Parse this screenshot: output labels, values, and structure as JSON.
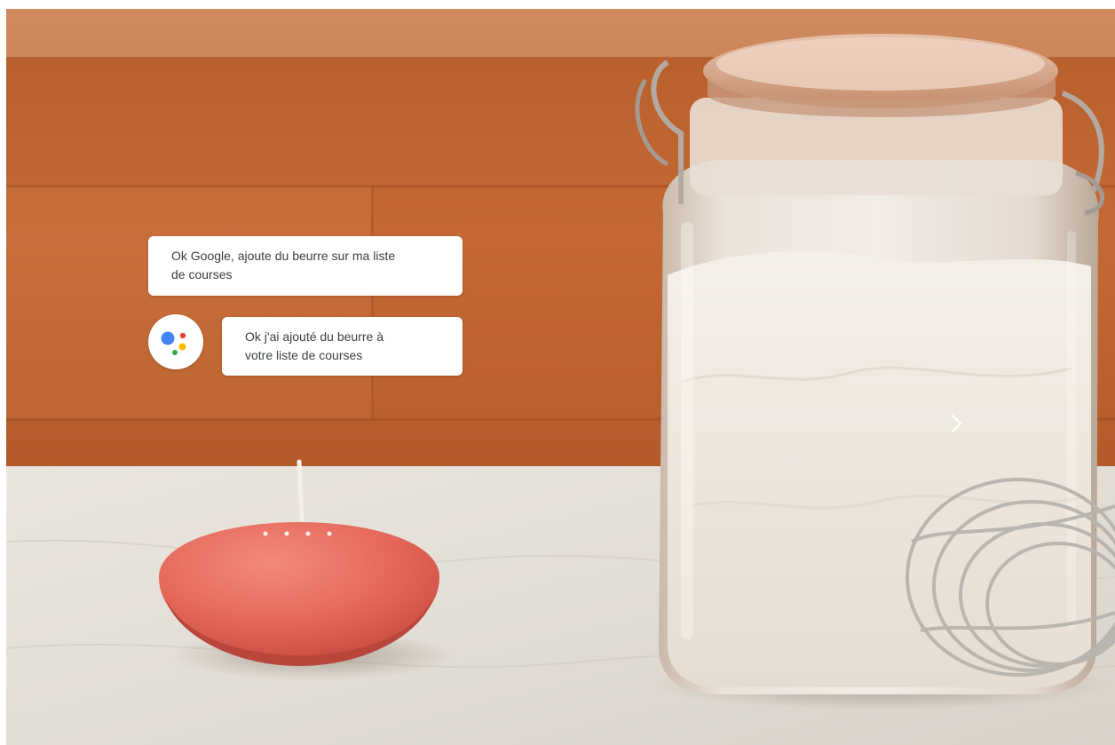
{
  "carousel": {
    "user_message": "Ok Google, ajoute du beurre sur ma liste\nde courses",
    "assistant_message": "Ok j'ai ajouté du beurre à\nvotre liste de courses",
    "next_icon": "chevron-right-icon",
    "assistant_icon": "google-assistant-icon"
  },
  "colors": {
    "assistant_blue": "#4285F4",
    "assistant_red": "#EA4335",
    "assistant_yellow": "#FBBC05",
    "assistant_green": "#34A853",
    "speaker_coral": "#E8665A",
    "wall_wood": "#C56A36",
    "counter_marble": "#E6E1DA"
  }
}
